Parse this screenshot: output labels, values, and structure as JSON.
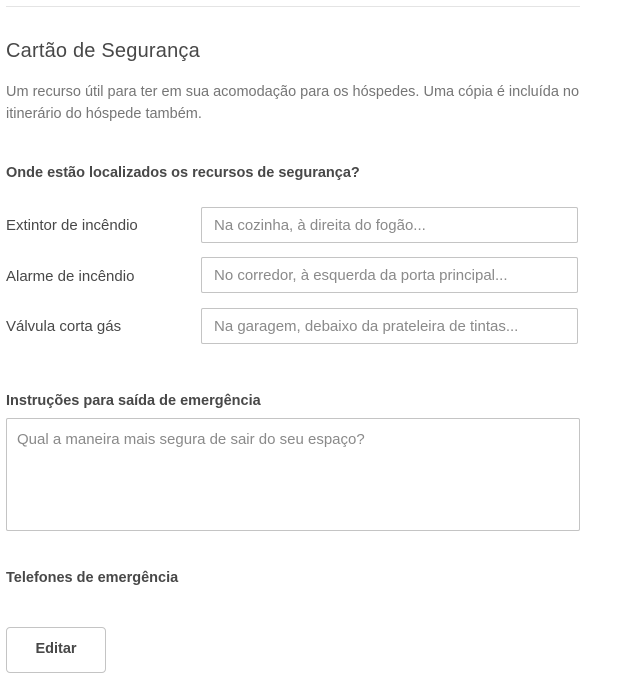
{
  "section": {
    "title": "Cartão de Segurança",
    "description": "Um recurso útil para ter em sua acomodação para os hóspedes. Uma cópia é incluída no itinerário do hóspede também."
  },
  "location_question": "Onde estão localizados os recursos de segurança?",
  "fields": [
    {
      "label": "Extintor de incêndio",
      "placeholder": "Na cozinha, à direita do fogão...",
      "value": ""
    },
    {
      "label": "Alarme de incêndio",
      "placeholder": "No corredor, à esquerda da porta principal...",
      "value": ""
    },
    {
      "label": "Válvula corta gás",
      "placeholder": "Na garagem, debaixo da prateleira de tintas...",
      "value": ""
    }
  ],
  "exit": {
    "label": "Instruções para saída de emergência",
    "placeholder": "Qual a maneira mais segura de sair do seu espaço?",
    "value": ""
  },
  "phones": {
    "label": "Telefones de emergência",
    "edit_label": "Editar"
  }
}
